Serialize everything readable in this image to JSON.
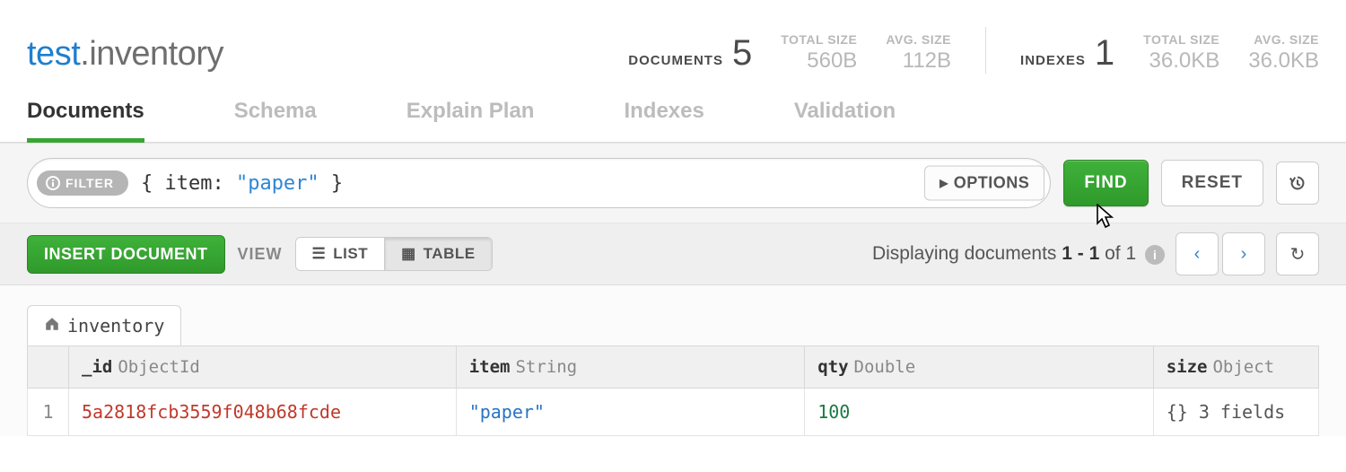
{
  "header": {
    "db": "test",
    "collection": "inventory",
    "documents": {
      "label": "documents",
      "count": "5",
      "total_size_label": "TOTAL SIZE",
      "total_size": "560B",
      "avg_size_label": "AVG. SIZE",
      "avg_size": "112B"
    },
    "indexes": {
      "label": "indexes",
      "count": "1",
      "total_size_label": "TOTAL SIZE",
      "total_size": "36.0KB",
      "avg_size_label": "AVG. SIZE",
      "avg_size": "36.0KB"
    }
  },
  "tabs": {
    "documents": "Documents",
    "schema": "Schema",
    "explain_plan": "Explain Plan",
    "indexes": "Indexes",
    "validation": "Validation"
  },
  "filter": {
    "pill": "FILTER",
    "query_raw": "{ item: \"paper\" }",
    "options": "OPTIONS",
    "find": "FIND",
    "reset": "RESET"
  },
  "toolbar": {
    "insert": "INSERT DOCUMENT",
    "view_label": "VIEW",
    "list": "LIST",
    "table": "TABLE",
    "displaying_pre": "Displaying documents ",
    "range": "1 - 1",
    "of_text": " of ",
    "total": "1"
  },
  "breadcrumb": {
    "collection": "inventory"
  },
  "columns": [
    {
      "field": "_id",
      "type": "ObjectId"
    },
    {
      "field": "item",
      "type": "String"
    },
    {
      "field": "qty",
      "type": "Double"
    },
    {
      "field": "size",
      "type": "Object"
    }
  ],
  "rows": [
    {
      "rownum": "1",
      "_id": "5a2818fcb3559f048b68fcde",
      "item": "\"paper\"",
      "qty": "100",
      "size": "{} 3 fields"
    }
  ]
}
